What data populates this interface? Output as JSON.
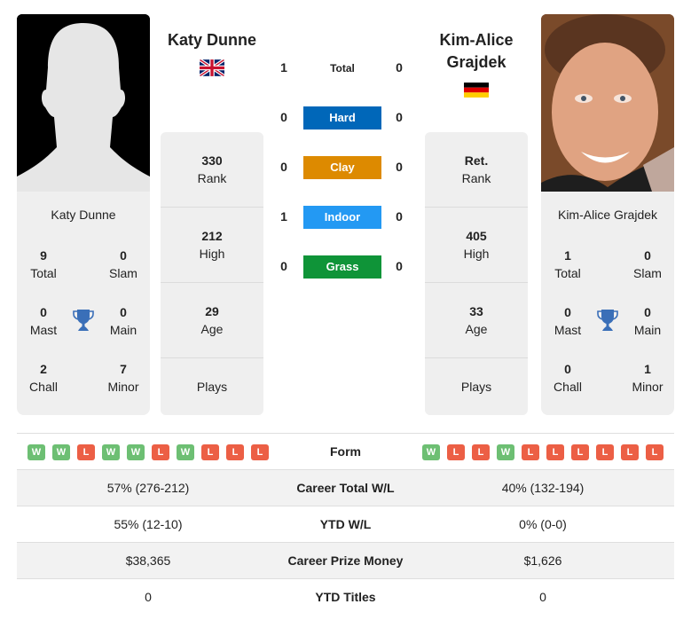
{
  "colors": {
    "hard": "#0067b9",
    "clay": "#dd8a00",
    "indoor": "#2399f3",
    "grass": "#0f9438",
    "win": "#6dbf73",
    "loss": "#ec5f45",
    "trophy": "#3a6fb8"
  },
  "player1": {
    "name": "Katy Dunne",
    "card_name": "Katy Dunne",
    "flag": "gb-flag",
    "photo": "silhouette-placeholder",
    "titles": {
      "total": {
        "value": "9",
        "label": "Total"
      },
      "slam": {
        "value": "0",
        "label": "Slam"
      },
      "mast": {
        "value": "0",
        "label": "Mast"
      },
      "main": {
        "value": "0",
        "label": "Main"
      },
      "chall": {
        "value": "2",
        "label": "Chall"
      },
      "minor": {
        "value": "7",
        "label": "Minor"
      }
    },
    "rank": {
      "value": "330",
      "label": "Rank"
    },
    "high": {
      "value": "212",
      "label": "High"
    },
    "age": {
      "value": "29",
      "label": "Age"
    },
    "plays": {
      "value": "",
      "label": "Plays"
    },
    "form": [
      "W",
      "W",
      "L",
      "W",
      "W",
      "L",
      "W",
      "L",
      "L",
      "L"
    ]
  },
  "player2": {
    "name_line1": "Kim-Alice",
    "name_line2": "Grajdek",
    "card_name": "Kim-Alice Grajdek",
    "flag": "de-flag",
    "photo": "player-photo",
    "titles": {
      "total": {
        "value": "1",
        "label": "Total"
      },
      "slam": {
        "value": "0",
        "label": "Slam"
      },
      "mast": {
        "value": "0",
        "label": "Mast"
      },
      "main": {
        "value": "0",
        "label": "Main"
      },
      "chall": {
        "value": "0",
        "label": "Chall"
      },
      "minor": {
        "value": "1",
        "label": "Minor"
      }
    },
    "rank": {
      "value": "Ret.",
      "label": "Rank"
    },
    "high": {
      "value": "405",
      "label": "High"
    },
    "age": {
      "value": "33",
      "label": "Age"
    },
    "plays": {
      "value": "",
      "label": "Plays"
    },
    "form": [
      "W",
      "L",
      "L",
      "W",
      "L",
      "L",
      "L",
      "L",
      "L",
      "L"
    ]
  },
  "h2h": [
    {
      "label": "Total",
      "left": "1",
      "right": "0",
      "style": "plain"
    },
    {
      "label": "Hard",
      "left": "0",
      "right": "0",
      "style": "hard"
    },
    {
      "label": "Clay",
      "left": "0",
      "right": "0",
      "style": "clay"
    },
    {
      "label": "Indoor",
      "left": "1",
      "right": "0",
      "style": "indoor"
    },
    {
      "label": "Grass",
      "left": "0",
      "right": "0",
      "style": "grass"
    }
  ],
  "table": {
    "form_label": "Form",
    "rows": [
      {
        "label": "Career Total W/L",
        "left": "57% (276-212)",
        "right": "40% (132-194)"
      },
      {
        "label": "YTD W/L",
        "left": "55% (12-10)",
        "right": "0% (0-0)"
      },
      {
        "label": "Career Prize Money",
        "left": "$38,365",
        "right": "$1,626"
      },
      {
        "label": "YTD Titles",
        "left": "0",
        "right": "0"
      }
    ]
  }
}
